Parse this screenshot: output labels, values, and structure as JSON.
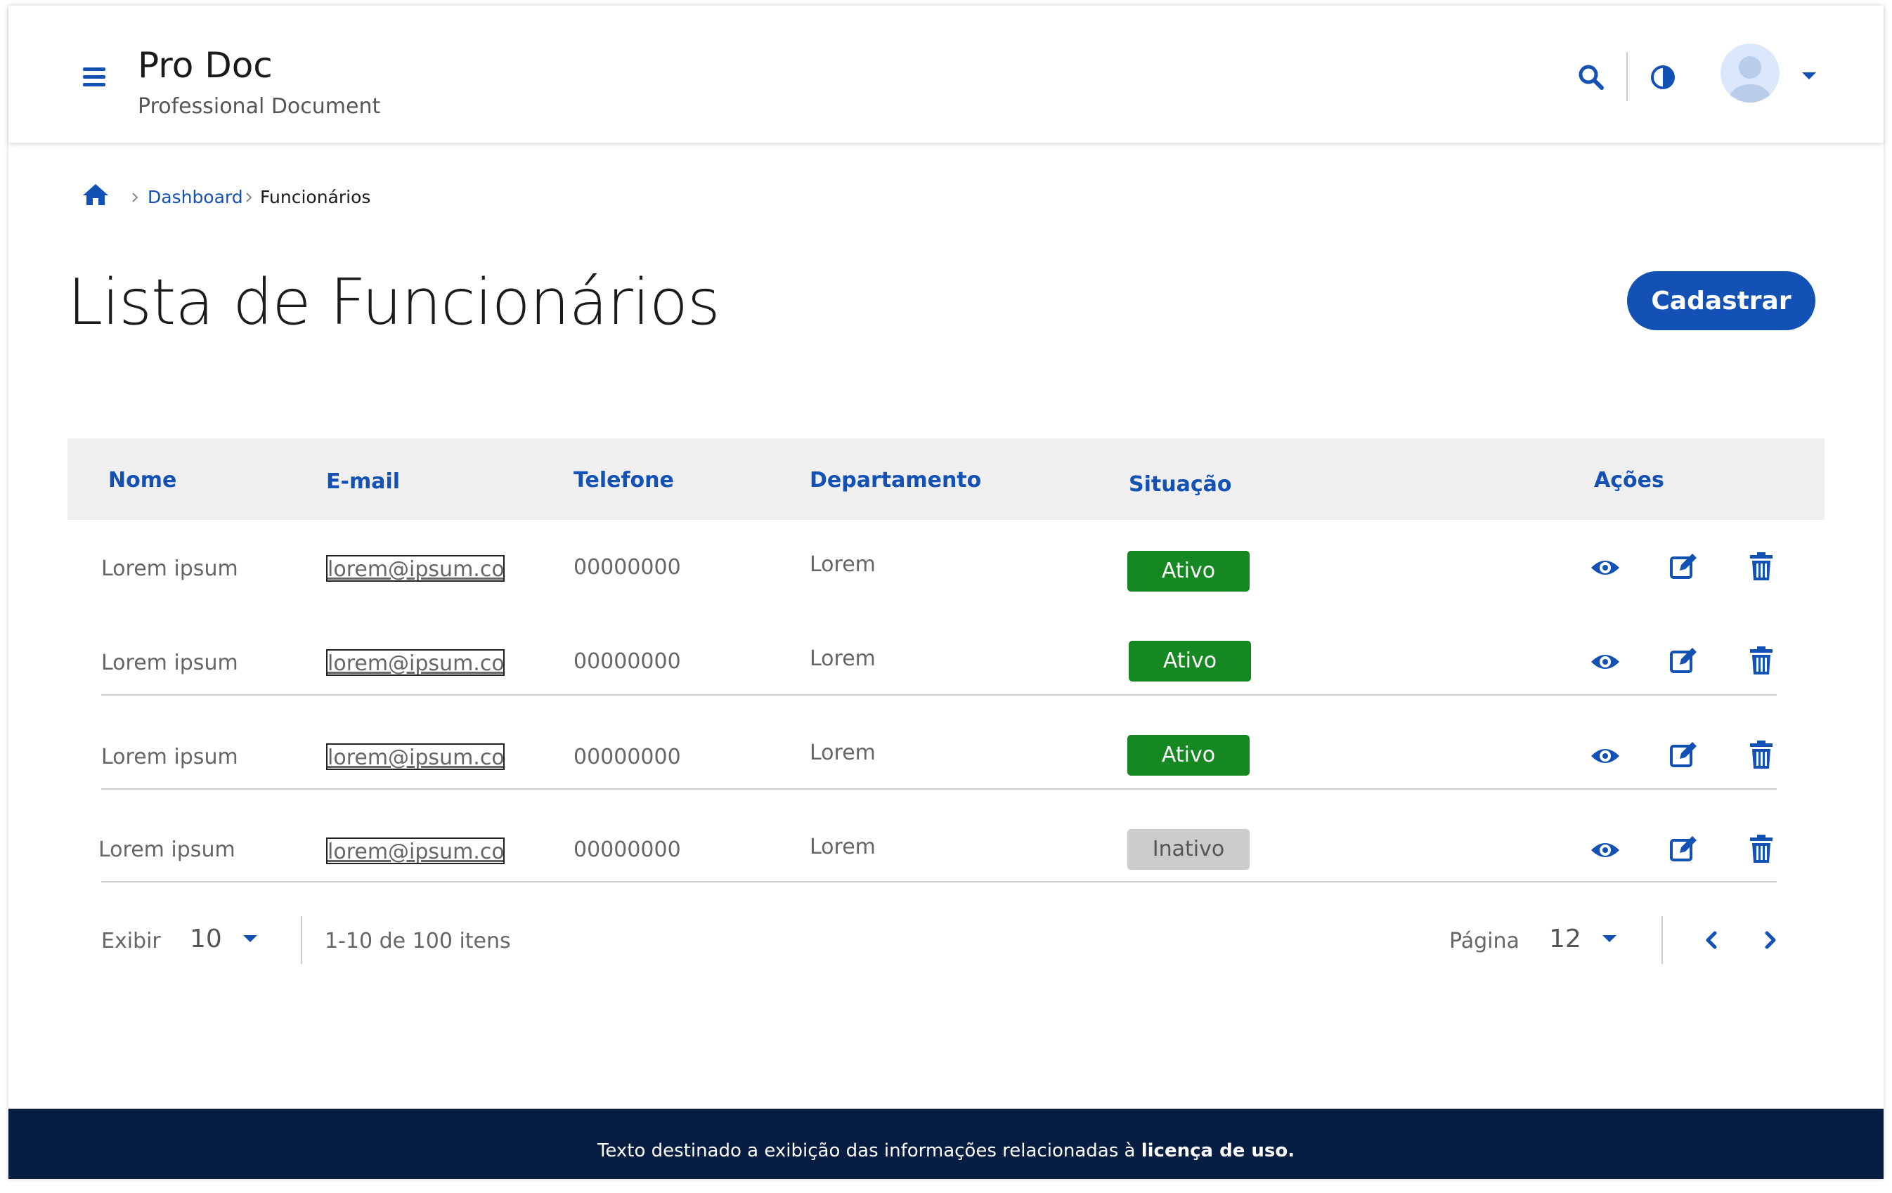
{
  "header": {
    "title": "Pro Doc",
    "subtitle": "Professional Document",
    "icons": [
      "menu-icon",
      "search-icon",
      "contrast-icon",
      "user-avatar-icon",
      "chevron-down-icon"
    ]
  },
  "breadcrumb": {
    "home_icon": "home-icon",
    "items": [
      "Dashboard",
      "Funcionários"
    ]
  },
  "page": {
    "title": "Lista de Funcionários",
    "register_button": "Cadastrar"
  },
  "table": {
    "columns": [
      "Nome",
      "E-mail",
      "Telefone",
      "Departamento",
      "Situação",
      "Ações"
    ],
    "rows": [
      {
        "name": "Lorem ipsum",
        "email": "lorem@ipsum.com",
        "phone": "00000000",
        "department": "Lorem",
        "status": "Ativo"
      },
      {
        "name": "Lorem ipsum",
        "email": "lorem@ipsum.com",
        "phone": "00000000",
        "department": "Lorem",
        "status": "Ativo"
      },
      {
        "name": "Lorem ipsum",
        "email": "lorem@ipsum.com",
        "phone": "00000000",
        "department": "Lorem",
        "status": "Ativo"
      },
      {
        "name": "Lorem ipsum",
        "email": "lorem@ipsum.com",
        "phone": "00000000",
        "department": "Lorem",
        "status": "Inativo"
      }
    ],
    "action_icons": [
      "eye-icon",
      "edit-icon",
      "trash-icon"
    ]
  },
  "pagination": {
    "show_label": "Exibir",
    "per_page": "10",
    "range_text": "1-10 de 100 itens",
    "page_label": "Página",
    "page": "12"
  },
  "footer": {
    "text": "Texto destinado a exibição das informações relacionadas à ",
    "bold": "licença de uso."
  },
  "colors": {
    "primary": "#1351b4",
    "active": "#168821",
    "inactive": "#cccccc",
    "footer_bg": "#071d41",
    "table_header_bg": "#efefef"
  }
}
